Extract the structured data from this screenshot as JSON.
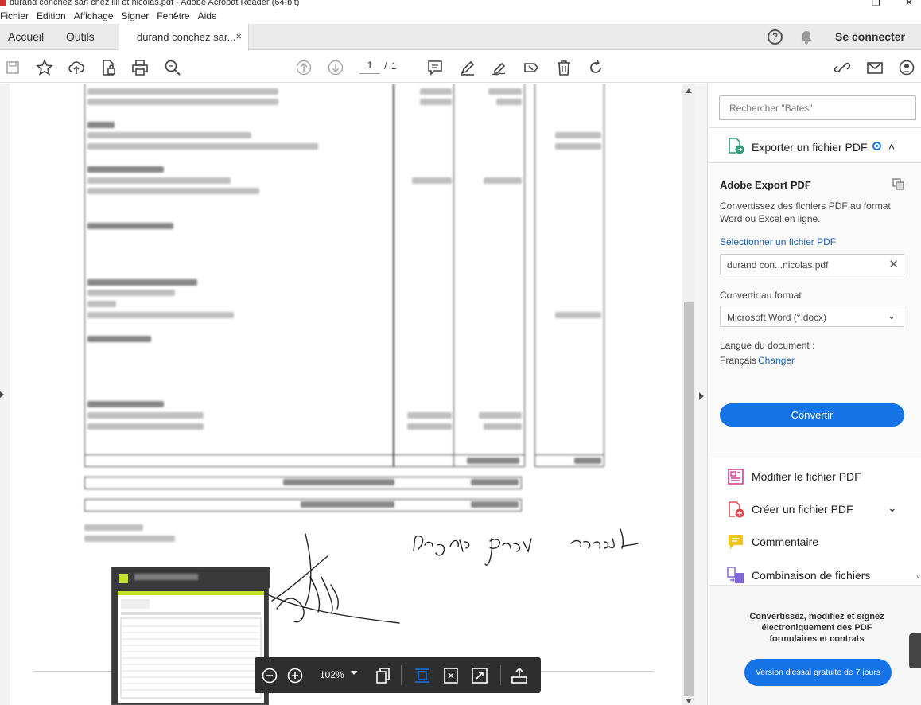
{
  "window": {
    "title": "durand conchez sarl chez lili et nicolas.pdf - Adobe Acrobat Reader (64-bit)"
  },
  "menu": [
    "Fichier",
    "Edition",
    "Affichage",
    "Signer",
    "Fenêtre",
    "Aide"
  ],
  "tabs": {
    "home": "Accueil",
    "tools": "Outils",
    "document": "durand conchez sar...",
    "close": "×"
  },
  "header": {
    "help": "?",
    "signin": "Se connecter"
  },
  "toolbar": {
    "page_current": "1",
    "page_separator": "/",
    "page_total": "1"
  },
  "zoom": {
    "level": "102%"
  },
  "sidebar": {
    "search_placeholder": "Rechercher \"Bates\"",
    "export": {
      "title": "Exporter un fichier PDF",
      "chevron": "˄",
      "heading": "Adobe Export PDF",
      "description": "Convertissez des fichiers PDF au format Word ou Excel en ligne.",
      "select_link": "Sélectionner un fichier PDF",
      "file_name": "durand con...nicolas.pdf",
      "file_clear": "✕",
      "convert_label": "Convertir au format",
      "format": "Microsoft Word (*.docx)",
      "format_chevron": "⌄",
      "lang_label": "Langue du document :",
      "lang_value": "Français",
      "lang_change": "Changer",
      "convert_button": "Convertir"
    },
    "tools": [
      {
        "label": "Modifier le fichier PDF",
        "chevron": ""
      },
      {
        "label": "Créer un fichier PDF",
        "chevron": "⌄"
      },
      {
        "label": "Commentaire",
        "chevron": ""
      },
      {
        "label": "Combinaison de fichiers",
        "chevron": ""
      }
    ],
    "promo": {
      "text": "Convertissez, modifiez et signez électroniquement des PDF formulaires et contrats",
      "button": "Version d'essai gratuite de 7 jours"
    }
  },
  "colors": {
    "accent": "#1473e6",
    "edit_tool": "#d83790",
    "create_tool": "#e34850",
    "comment_tool": "#f0c419",
    "combine_tool": "#8066d9"
  }
}
